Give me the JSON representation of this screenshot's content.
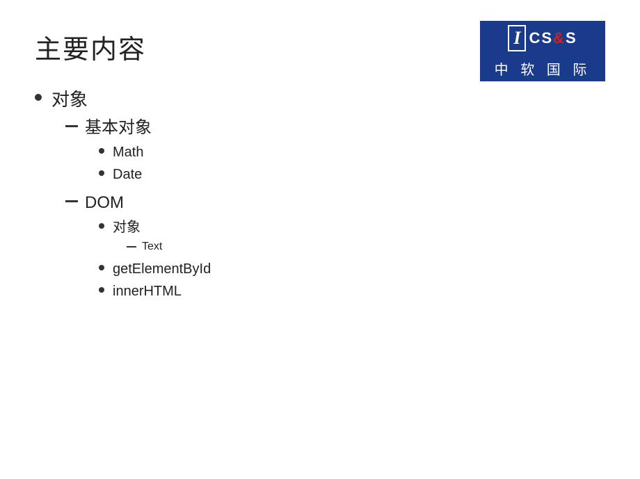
{
  "slide": {
    "title": "主要内容",
    "logo": {
      "letter": "I",
      "brand": "CS&S",
      "chinese": "中 软 国 际"
    },
    "content": {
      "items": [
        {
          "label": "对象",
          "level": 1,
          "children": [
            {
              "label": "基本对象",
              "level": 2,
              "children": [
                {
                  "label": "Math",
                  "level": 3
                },
                {
                  "label": "Date",
                  "level": 3
                }
              ]
            },
            {
              "label": "DOM",
              "level": 2,
              "children": [
                {
                  "label": "对象",
                  "level": 3,
                  "children": [
                    {
                      "label": "Text",
                      "level": 4
                    }
                  ]
                },
                {
                  "label": "getElementById",
                  "level": 3
                },
                {
                  "label": "innerHTML",
                  "level": 3
                }
              ]
            }
          ]
        }
      ]
    }
  }
}
